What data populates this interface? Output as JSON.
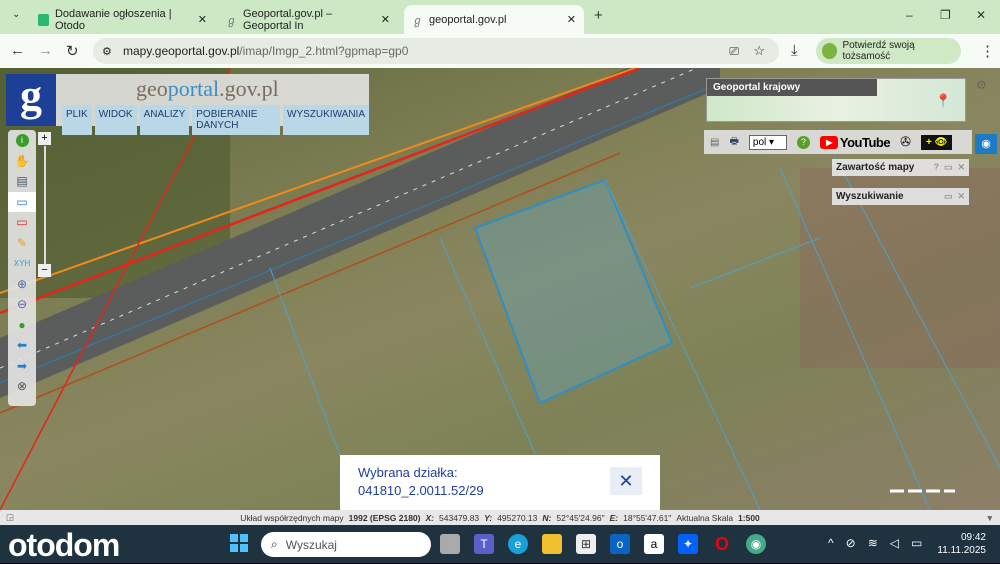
{
  "browser": {
    "tabs": [
      {
        "title": "Dodawanie ogłoszenia | Otodo",
        "favicon_color": "#2bb673",
        "active": false
      },
      {
        "title": "Geoportal.gov.pl – Geoportal In",
        "favicon_color": "#888888",
        "active": false
      },
      {
        "title": "geoportal.gov.pl",
        "favicon_color": "#888888",
        "active": true
      }
    ],
    "new_tab": "+",
    "url_host": "mapy.geoportal.gov.pl",
    "url_path": "/imap/Imgp_2.html?gpmap=gp0",
    "verify_label": "Potwierdź swoją tożsamość",
    "window_controls": [
      "–",
      "❐",
      "✕"
    ]
  },
  "geoportal": {
    "logo_letter": "g",
    "title_a": "geo",
    "title_b": "portal",
    "title_c": ".gov.pl",
    "menu": [
      "PLIK",
      "WIDOK",
      "ANALIZY",
      "POBIERANIE DANYCH",
      "WYSZUKIWANIA"
    ],
    "tools": [
      "info-icon",
      "hand-icon",
      "legend-icon",
      "select-rect-icon",
      "select-red-icon",
      "pencil-icon",
      "xyh-icon",
      "zoom-in-icon",
      "zoom-out-icon",
      "globe-icon",
      "back-arrow-icon",
      "forward-arrow-icon",
      "full-extent-icon"
    ],
    "xyh_label": "XYH",
    "minimap_title": "Geoportal krajowy",
    "language": "pol",
    "youtube_label": "YouTube",
    "eye_label": "+ 👁",
    "panels": [
      {
        "title": "Zawartość mapy",
        "help": "?"
      },
      {
        "title": "Wyszukiwanie"
      }
    ],
    "popup": {
      "label": "Wybrana działka:",
      "value": "041810_2.0011.52/29"
    },
    "status": {
      "crs_label": "Układ współrzędnych mapy",
      "crs_value": "1992 (EPSG 2180)",
      "x_label": "X:",
      "x_value": "543479.83",
      "y_label": "Y:",
      "y_value": "495270.13",
      "n_label": "N:",
      "n_value": "52°45'24.96\"",
      "e_label": "E:",
      "e_value": "18°55'47.61\"",
      "scale_label": "Aktualna Skala",
      "scale_value": "1:500"
    }
  },
  "taskbar": {
    "brand": "otodom",
    "search_placeholder": "Wyszukaj",
    "time": "09:42",
    "date": "11.11.2025"
  }
}
